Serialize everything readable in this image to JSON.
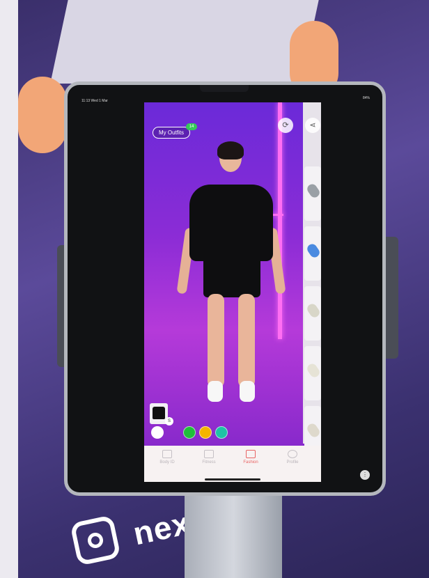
{
  "poster": {
    "brand_word": "nexi"
  },
  "device": {
    "status_time": "11:13",
    "status_date": "Wed 1 Mar",
    "status_battery": "84%"
  },
  "app": {
    "my_outfits_label": "My Outfits",
    "outfit_count": "14",
    "selected_size": "S",
    "color_swatches": [
      "#ffffff",
      "#1fbf3a",
      "#f5b400",
      "#1fc3a6"
    ],
    "nav": [
      {
        "label": "Body ID",
        "icon": "id-card-icon",
        "active": false
      },
      {
        "label": "Fitness",
        "icon": "heartbeat-icon",
        "active": false
      },
      {
        "label": "Fashion",
        "icon": "tshirt-icon",
        "active": true
      },
      {
        "label": "Profile",
        "icon": "profile-icon",
        "active": false
      }
    ]
  }
}
